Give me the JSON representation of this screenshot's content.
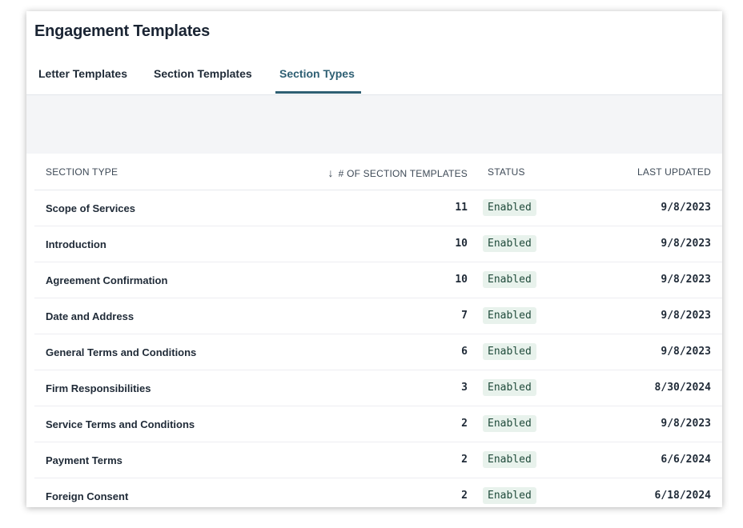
{
  "page": {
    "title": "Engagement Templates"
  },
  "tabs": [
    {
      "label": "Letter Templates",
      "active": false
    },
    {
      "label": "Section Templates",
      "active": false
    },
    {
      "label": "Section Types",
      "active": true
    }
  ],
  "table": {
    "columns": {
      "section_type": "SECTION TYPE",
      "count": "# OF SECTION TEMPLATES",
      "status": "STATUS",
      "last_updated": "LAST UPDATED"
    },
    "sort_icon": "arrow-down-icon",
    "rows": [
      {
        "name": "Scope of Services",
        "count": "11",
        "status": "Enabled",
        "date": "9/8/2023"
      },
      {
        "name": "Introduction",
        "count": "10",
        "status": "Enabled",
        "date": "9/8/2023"
      },
      {
        "name": "Agreement Confirmation",
        "count": "10",
        "status": "Enabled",
        "date": "9/8/2023"
      },
      {
        "name": "Date and Address",
        "count": "7",
        "status": "Enabled",
        "date": "9/8/2023"
      },
      {
        "name": "General Terms and Conditions",
        "count": "6",
        "status": "Enabled",
        "date": "9/8/2023"
      },
      {
        "name": "Firm Responsibilities",
        "count": "3",
        "status": "Enabled",
        "date": "8/30/2024"
      },
      {
        "name": "Service Terms and Conditions",
        "count": "2",
        "status": "Enabled",
        "date": "9/8/2023"
      },
      {
        "name": "Payment Terms",
        "count": "2",
        "status": "Enabled",
        "date": "6/6/2024"
      },
      {
        "name": "Foreign Consent",
        "count": "2",
        "status": "Enabled",
        "date": "6/18/2024"
      }
    ]
  },
  "colors": {
    "accent": "#2e5f73",
    "badge_bg": "#e8f2ec",
    "band_bg": "#f4f5f7"
  }
}
